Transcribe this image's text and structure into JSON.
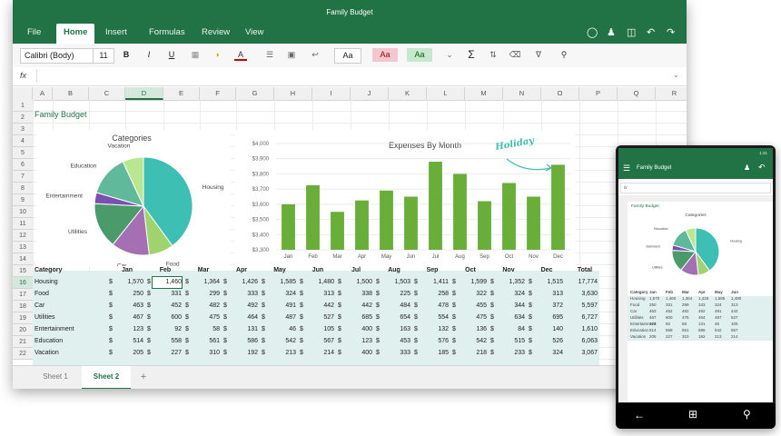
{
  "app": {
    "title": "Family Budget"
  },
  "tabs": [
    "File",
    "Home",
    "Insert",
    "Formulas",
    "Review",
    "View"
  ],
  "active_tab": "Home",
  "ribbon": {
    "font_name": "Calibri (Body)",
    "font_size": "11",
    "bold": "B",
    "italic": "I",
    "underline": "U",
    "font_color_glyph": "A",
    "style_normal": "Aa",
    "style_bad": "Aa",
    "style_good": "Aa",
    "sum_glyph": "Σ"
  },
  "formula_bar": {
    "fx": "fx",
    "value": ""
  },
  "columns": [
    "A",
    "B",
    "C",
    "D",
    "E",
    "F",
    "G",
    "H",
    "I",
    "J",
    "K",
    "L",
    "M",
    "N",
    "O",
    "P",
    "Q",
    "R"
  ],
  "selected_column": "D",
  "rows": [
    "1",
    "2",
    "3",
    "4",
    "5",
    "6",
    "7",
    "8",
    "9",
    "10",
    "11",
    "12",
    "13",
    "14",
    "15",
    "16",
    "17",
    "18",
    "19",
    "20",
    "21",
    "22"
  ],
  "selected_row": "16",
  "sheet": {
    "title_cell": "Family Budget",
    "header": [
      "Category",
      "Jan",
      "Feb",
      "Mar",
      "Apr",
      "May",
      "Jun",
      "Jul",
      "Aug",
      "Sep",
      "Oct",
      "Nov",
      "Dec",
      "Total"
    ],
    "currency": "$",
    "data": [
      {
        "category": "Housing",
        "values": [
          "1,570",
          "1,460",
          "1,364",
          "1,426",
          "1,585",
          "1,480",
          "1,500",
          "1,503",
          "1,411",
          "1,599",
          "1,352",
          "1,515"
        ],
        "total": "17,774"
      },
      {
        "category": "Food",
        "values": [
          "250",
          "331",
          "299",
          "333",
          "324",
          "313",
          "338",
          "225",
          "258",
          "322",
          "324",
          "313"
        ],
        "total": "3,630"
      },
      {
        "category": "Car",
        "values": [
          "463",
          "452",
          "482",
          "492",
          "491",
          "442",
          "442",
          "484",
          "478",
          "455",
          "344",
          "372"
        ],
        "total": "5,597"
      },
      {
        "category": "Utilities",
        "values": [
          "467",
          "600",
          "475",
          "464",
          "487",
          "527",
          "685",
          "654",
          "554",
          "475",
          "634",
          "695"
        ],
        "total": "6,727"
      },
      {
        "category": "Entertainment",
        "values": [
          "123",
          "92",
          "58",
          "131",
          "46",
          "105",
          "400",
          "163",
          "132",
          "136",
          "84",
          "140"
        ],
        "total": "1,610"
      },
      {
        "category": "Education",
        "values": [
          "514",
          "558",
          "561",
          "586",
          "542",
          "567",
          "123",
          "453",
          "576",
          "542",
          "515",
          "526"
        ],
        "total": "6,063"
      },
      {
        "category": "Vacation",
        "values": [
          "205",
          "227",
          "310",
          "192",
          "213",
          "214",
          "400",
          "333",
          "185",
          "218",
          "233",
          "324"
        ],
        "total": "3,067"
      }
    ]
  },
  "sheet_tabs": [
    "Sheet 1",
    "Sheet 2"
  ],
  "active_sheet": "Sheet 2",
  "add_sheet_glyph": "+",
  "chart_data": [
    {
      "type": "pie",
      "title": "Categories",
      "categories": [
        "Housing",
        "Food",
        "Car",
        "Utilities",
        "Entertainment",
        "Education",
        "Vacation"
      ],
      "values": [
        17774,
        3630,
        5597,
        6727,
        1610,
        6063,
        3067
      ],
      "colors": [
        "#3dbfb4",
        "#9fd36f",
        "#a46fb3",
        "#4a9a6a",
        "#7b4fb0",
        "#5fb99a",
        "#b9e78f"
      ]
    },
    {
      "type": "bar",
      "title": "Expenses By Month",
      "categories": [
        "Jan",
        "Feb",
        "Mar",
        "Apr",
        "May",
        "Jun",
        "Jul",
        "Aug",
        "Sep",
        "Oct",
        "Nov",
        "Dec"
      ],
      "values": [
        3600,
        3725,
        3550,
        3625,
        3690,
        3650,
        3880,
        3800,
        3620,
        3740,
        3650,
        3860
      ],
      "ylim": [
        3300,
        4000
      ],
      "yticks": [
        "$3,300",
        "$3,400",
        "$3,500",
        "$3,600",
        "$3,700",
        "$3,800",
        "$3,900",
        "$4,000"
      ],
      "color": "#6aae3a",
      "annotation": "Holiday"
    }
  ],
  "phone": {
    "title": "Family Budget",
    "status": "1:31",
    "sheet_title": "Family Budget",
    "chart_title": "Categories"
  }
}
